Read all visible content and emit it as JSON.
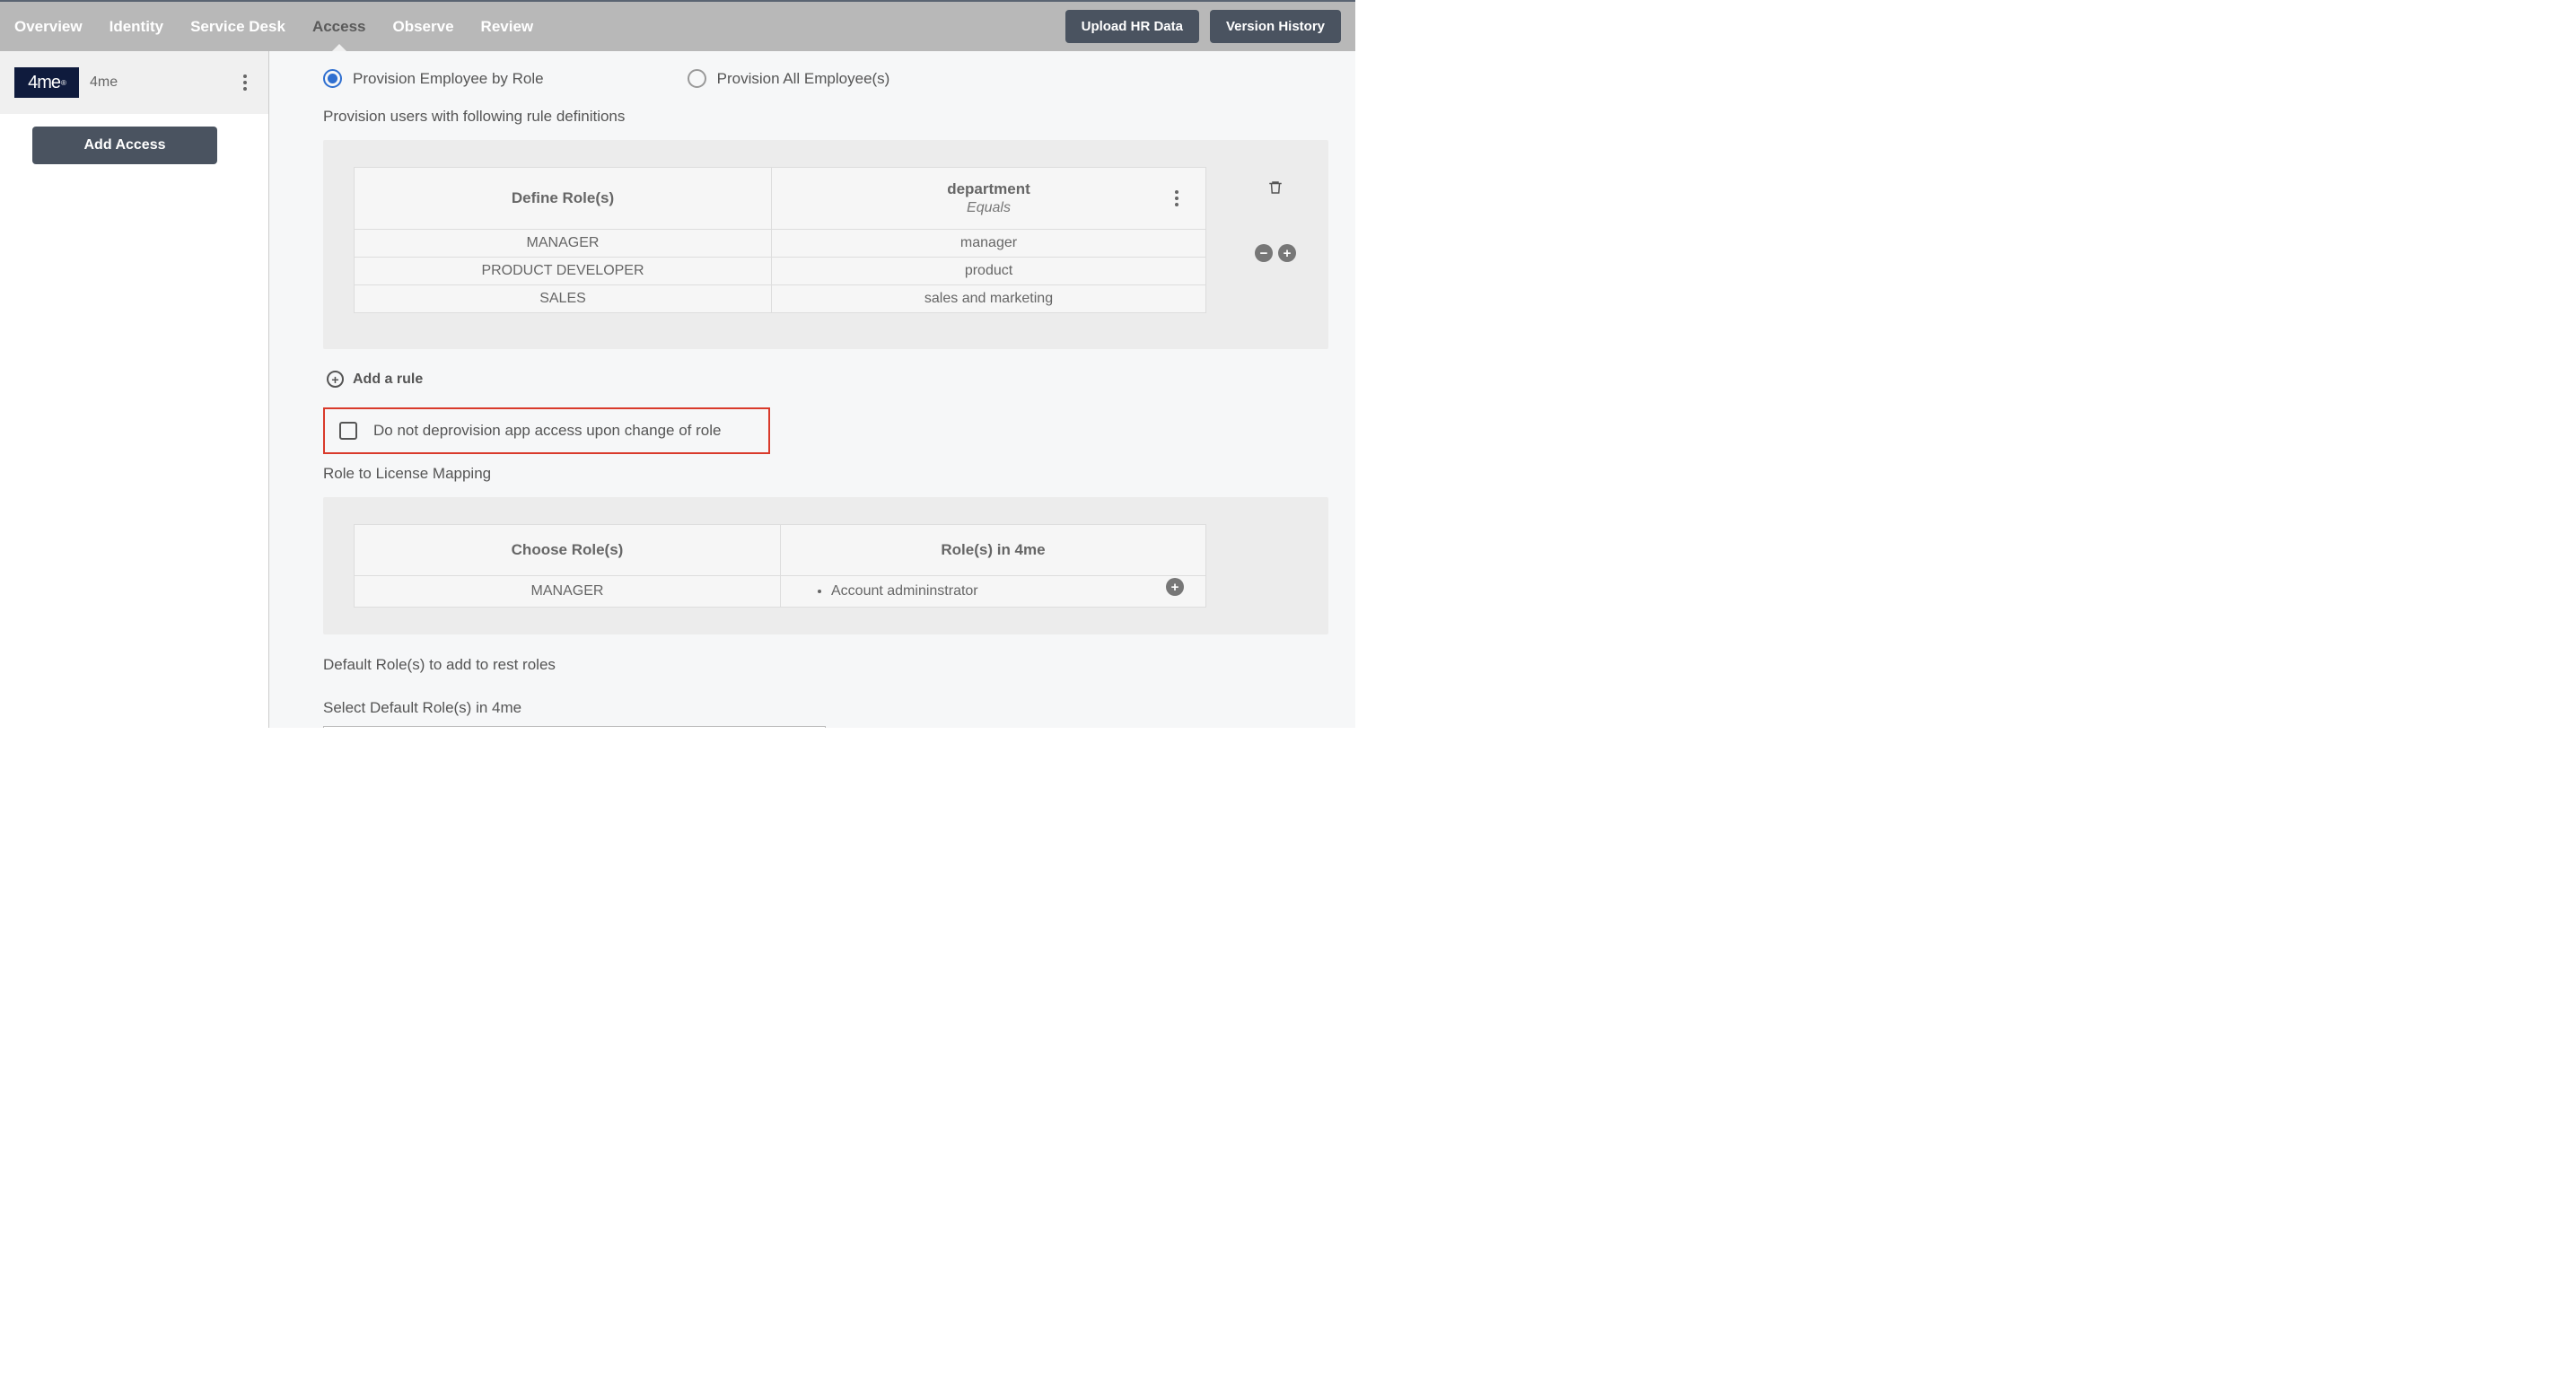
{
  "nav": {
    "items": [
      "Overview",
      "Identity",
      "Service Desk",
      "Access",
      "Observe",
      "Review"
    ],
    "active": "Access"
  },
  "topButtons": {
    "upload": "Upload HR Data",
    "version": "Version History"
  },
  "sidebar": {
    "app_logo_text": "4me",
    "app_name": "4me",
    "add_access": "Add Access"
  },
  "provision": {
    "options": [
      {
        "label": "Provision Employee by Role",
        "checked": true
      },
      {
        "label": "Provision All Employee(s)",
        "checked": false
      }
    ],
    "rules_heading": "Provision users with following rule definitions",
    "table": {
      "col1": "Define Role(s)",
      "col2_top": "department",
      "col2_sub": "Equals",
      "rows": [
        {
          "role": "MANAGER",
          "dept": "manager"
        },
        {
          "role": "PRODUCT DEVELOPER",
          "dept": "product"
        },
        {
          "role": "SALES",
          "dept": "sales and marketing"
        }
      ]
    },
    "add_rule": "Add a rule",
    "deprov_label": "Do not deprovision app access upon change of role"
  },
  "license_mapping": {
    "heading": "Role to License Mapping",
    "col1": "Choose Role(s)",
    "col2": "Role(s) in 4me",
    "rows": [
      {
        "role": "MANAGER",
        "mapped": [
          "Account admininstrator"
        ]
      }
    ]
  },
  "defaults": {
    "heading": "Default Role(s) to add to rest roles",
    "select_label": "Select Default Role(s) in 4me"
  }
}
